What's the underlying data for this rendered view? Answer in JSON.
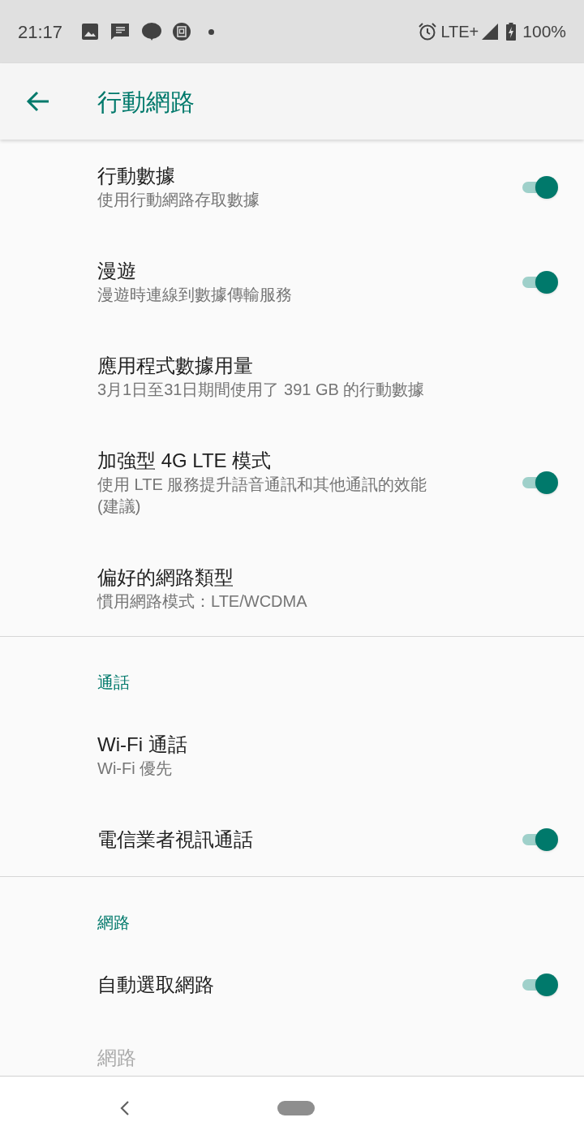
{
  "status_bar": {
    "time": "21:17",
    "network": "LTE+",
    "battery": "100%"
  },
  "app_bar": {
    "title": "行動網路"
  },
  "sections": [
    {
      "items": [
        {
          "title": "行動數據",
          "summary": [
            "使用行動網路存取數據"
          ],
          "has_toggle": true,
          "on": true,
          "disabled": false
        },
        {
          "title": "漫遊",
          "summary": [
            "漫遊時連線到數據傳輸服務"
          ],
          "has_toggle": true,
          "on": true,
          "disabled": false
        },
        {
          "title": "應用程式數據用量",
          "summary": [
            "3月1日至31日期間使用了 391 GB 的行動數據"
          ],
          "has_toggle": false,
          "disabled": false
        },
        {
          "title": "加強型 4G LTE 模式",
          "summary": [
            "使用 LTE 服務提升語音通訊和其他通訊的效能",
            "(建議)"
          ],
          "has_toggle": true,
          "on": true,
          "disabled": false
        },
        {
          "title": "偏好的網路類型",
          "summary": [
            "慣用網路模式：LTE/WCDMA"
          ],
          "has_toggle": false,
          "disabled": false
        }
      ]
    },
    {
      "category": "通話",
      "items": [
        {
          "title": "Wi-Fi 通話",
          "summary": [
            "Wi-Fi 優先"
          ],
          "has_toggle": false,
          "disabled": false
        },
        {
          "title": "電信業者視訊通話",
          "has_toggle": true,
          "on": true,
          "disabled": false
        }
      ]
    },
    {
      "category": "網路",
      "items": [
        {
          "title": "自動選取網路",
          "has_toggle": true,
          "on": true,
          "disabled": false
        },
        {
          "title": "網路",
          "has_toggle": false,
          "disabled": true
        }
      ]
    }
  ]
}
